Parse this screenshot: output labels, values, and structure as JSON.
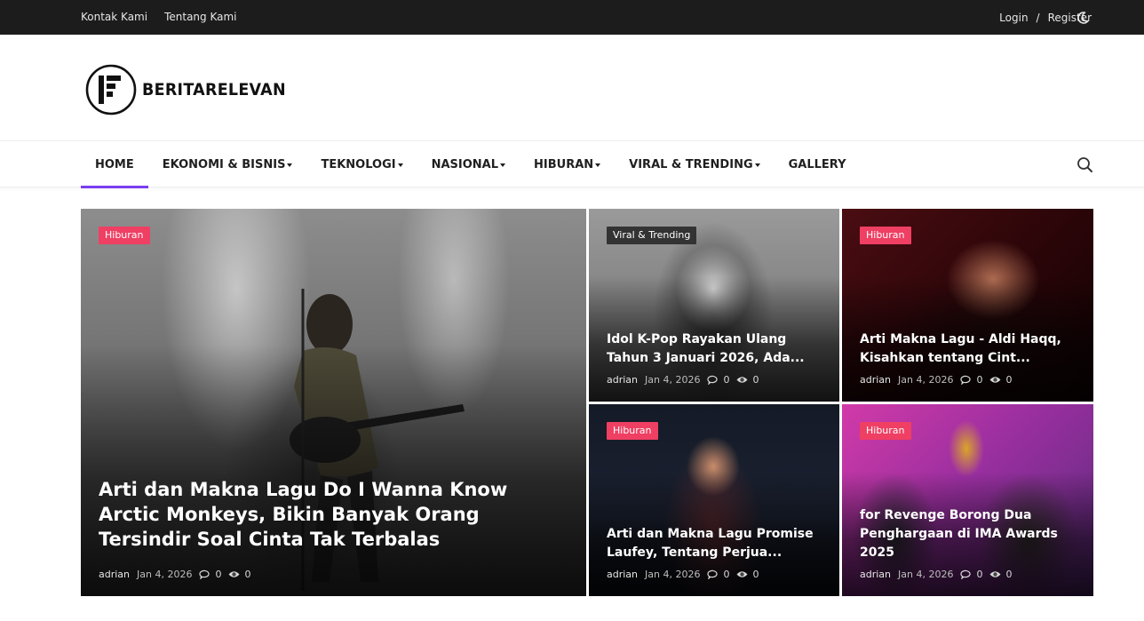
{
  "topbar": {
    "links": [
      "Kontak Kami",
      "Tentang Kami"
    ],
    "login": "Login",
    "separator": "/",
    "register": "Register",
    "theme_icon": "moon-icon"
  },
  "site": {
    "name": "BERITARELEVAN"
  },
  "nav": {
    "items": [
      {
        "label": "HOME",
        "active": true,
        "dropdown": false
      },
      {
        "label": "EKONOMI & BISNIS",
        "dropdown": true
      },
      {
        "label": "TEKNOLOGI",
        "dropdown": true
      },
      {
        "label": "NASIONAL",
        "dropdown": true
      },
      {
        "label": "HIBURAN",
        "dropdown": true
      },
      {
        "label": "VIRAL & TRENDING",
        "dropdown": true
      },
      {
        "label": "GALLERY",
        "dropdown": false
      }
    ],
    "search_icon": "search-icon",
    "accent": "#7a3cf0"
  },
  "featured": [
    {
      "category": "Hiburan",
      "title": "Arti dan Makna Lagu Do I Wanna Know Arctic Monkeys, Bikin Banyak Orang Tersindir Soal Cinta Tak Terbalas",
      "author": "adrian",
      "date": "Jan 4, 2026",
      "comments": "0",
      "views": "0"
    },
    {
      "category": "Viral & Trending",
      "title": "Idol K-Pop Rayakan Ulang Tahun 3 Januari 2026, Ada...",
      "author": "adrian",
      "date": "Jan 4, 2026",
      "comments": "0",
      "views": "0"
    },
    {
      "category": "Hiburan",
      "title": "Arti Makna Lagu - Aldi Haqq, Kisahkan tentang Cint...",
      "author": "adrian",
      "date": "Jan 4, 2026",
      "comments": "0",
      "views": "0"
    },
    {
      "category": "Hiburan",
      "title": "Arti dan Makna Lagu Promise Laufey, Tentang Perjua...",
      "author": "adrian",
      "date": "Jan 4, 2026",
      "comments": "0",
      "views": "0"
    },
    {
      "category": "Hiburan",
      "title": "for Revenge Borong Dua Penghargaan di IMA Awards 2025",
      "author": "adrian",
      "date": "Jan 4, 2026",
      "comments": "0",
      "views": "0"
    }
  ],
  "colors": {
    "badge": "#ef3f63",
    "badge_dark": "#333333",
    "topbar": "#1c1c1c"
  }
}
